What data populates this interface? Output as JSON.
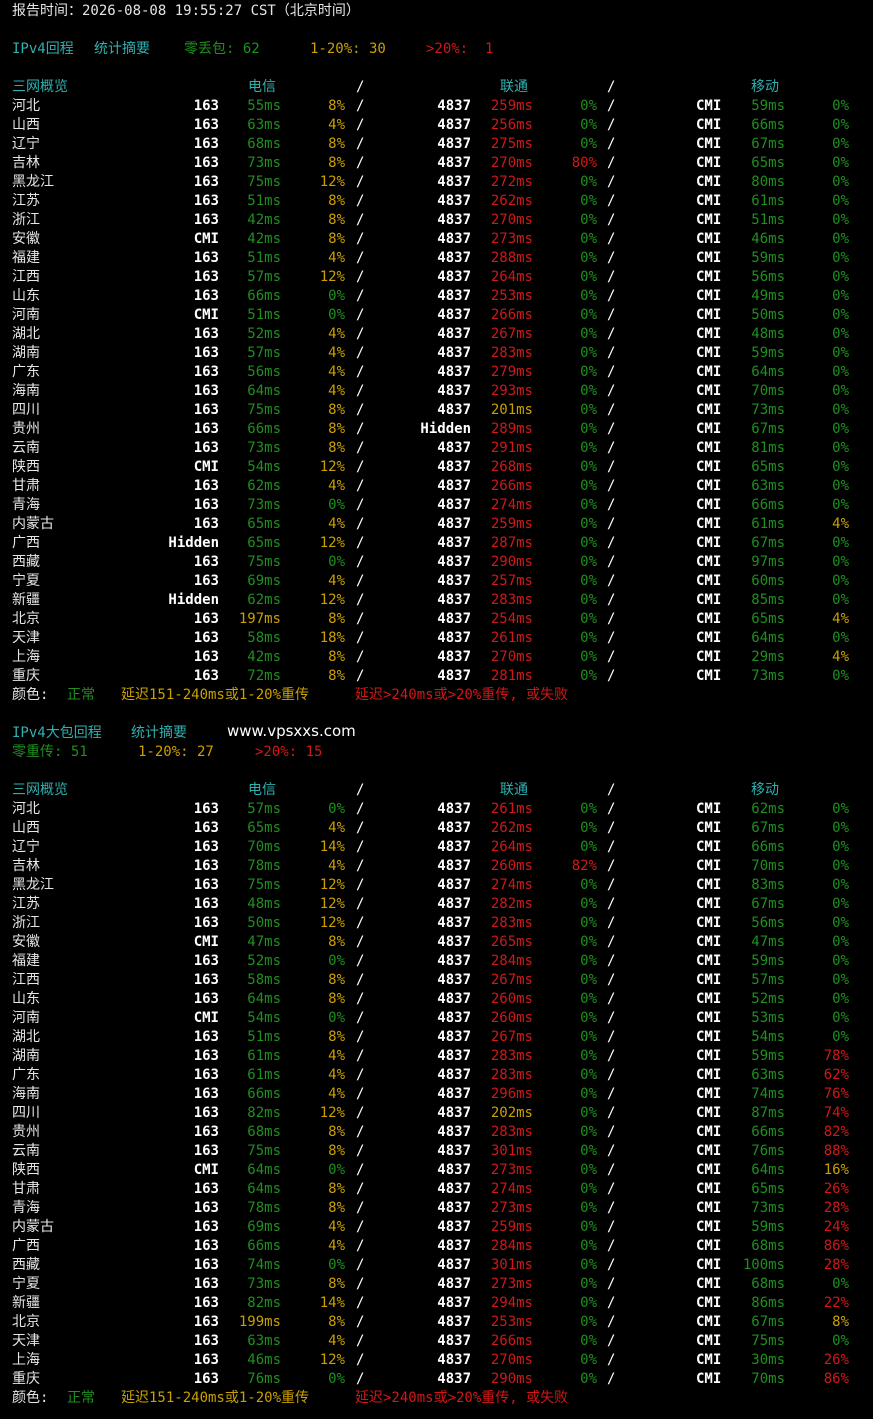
{
  "colors": {
    "green": "#1f8f1f",
    "yellow": "#c9a000",
    "red": "#d01818",
    "cyan": "#2fb0b0",
    "white": "#ffffff",
    "background": "#000000"
  },
  "report_time": "报告时间：2026-08-08 19:55:27 CST（北京时间）",
  "sections": [
    {
      "title_left": "IPv4回程",
      "title_right": "统计摘要",
      "stats": [
        {
          "text": "零丢包: 62",
          "color": "green"
        },
        {
          "text": "1-20%: 30",
          "color": "yellow"
        },
        {
          "text": ">20%:  1",
          "color": "red"
        }
      ],
      "watermark": "",
      "header": {
        "region": "三网概览",
        "telecom": "电信",
        "sep": "/",
        "unicom": "联通",
        "mobile": "移动"
      },
      "rows": [
        [
          "河北",
          "163",
          "55ms",
          "8%",
          "4837",
          "259ms",
          "0%",
          "CMI",
          "59ms",
          "0%"
        ],
        [
          "山西",
          "163",
          "63ms",
          "4%",
          "4837",
          "256ms",
          "0%",
          "CMI",
          "66ms",
          "0%"
        ],
        [
          "辽宁",
          "163",
          "68ms",
          "8%",
          "4837",
          "275ms",
          "0%",
          "CMI",
          "67ms",
          "0%"
        ],
        [
          "吉林",
          "163",
          "73ms",
          "8%",
          "4837",
          "270ms",
          "80%",
          "CMI",
          "65ms",
          "0%"
        ],
        [
          "黑龙江",
          "163",
          "75ms",
          "12%",
          "4837",
          "272ms",
          "0%",
          "CMI",
          "80ms",
          "0%"
        ],
        [
          "江苏",
          "163",
          "51ms",
          "8%",
          "4837",
          "262ms",
          "0%",
          "CMI",
          "61ms",
          "0%"
        ],
        [
          "浙江",
          "163",
          "42ms",
          "8%",
          "4837",
          "270ms",
          "0%",
          "CMI",
          "51ms",
          "0%"
        ],
        [
          "安徽",
          "CMI",
          "42ms",
          "8%",
          "4837",
          "273ms",
          "0%",
          "CMI",
          "46ms",
          "0%"
        ],
        [
          "福建",
          "163",
          "51ms",
          "4%",
          "4837",
          "288ms",
          "0%",
          "CMI",
          "59ms",
          "0%"
        ],
        [
          "江西",
          "163",
          "57ms",
          "12%",
          "4837",
          "264ms",
          "0%",
          "CMI",
          "56ms",
          "0%"
        ],
        [
          "山东",
          "163",
          "66ms",
          "0%",
          "4837",
          "253ms",
          "0%",
          "CMI",
          "49ms",
          "0%"
        ],
        [
          "河南",
          "CMI",
          "51ms",
          "0%",
          "4837",
          "266ms",
          "0%",
          "CMI",
          "50ms",
          "0%"
        ],
        [
          "湖北",
          "163",
          "52ms",
          "4%",
          "4837",
          "267ms",
          "0%",
          "CMI",
          "48ms",
          "0%"
        ],
        [
          "湖南",
          "163",
          "57ms",
          "4%",
          "4837",
          "283ms",
          "0%",
          "CMI",
          "59ms",
          "0%"
        ],
        [
          "广东",
          "163",
          "56ms",
          "4%",
          "4837",
          "279ms",
          "0%",
          "CMI",
          "64ms",
          "0%"
        ],
        [
          "海南",
          "163",
          "64ms",
          "4%",
          "4837",
          "293ms",
          "0%",
          "CMI",
          "70ms",
          "0%"
        ],
        [
          "四川",
          "163",
          "75ms",
          "8%",
          "4837",
          "201ms",
          "0%",
          "CMI",
          "73ms",
          "0%"
        ],
        [
          "贵州",
          "163",
          "66ms",
          "8%",
          "Hidden",
          "289ms",
          "0%",
          "CMI",
          "67ms",
          "0%"
        ],
        [
          "云南",
          "163",
          "73ms",
          "8%",
          "4837",
          "291ms",
          "0%",
          "CMI",
          "81ms",
          "0%"
        ],
        [
          "陕西",
          "CMI",
          "54ms",
          "12%",
          "4837",
          "268ms",
          "0%",
          "CMI",
          "65ms",
          "0%"
        ],
        [
          "甘肃",
          "163",
          "62ms",
          "4%",
          "4837",
          "266ms",
          "0%",
          "CMI",
          "63ms",
          "0%"
        ],
        [
          "青海",
          "163",
          "73ms",
          "0%",
          "4837",
          "274ms",
          "0%",
          "CMI",
          "66ms",
          "0%"
        ],
        [
          "内蒙古",
          "163",
          "65ms",
          "4%",
          "4837",
          "259ms",
          "0%",
          "CMI",
          "61ms",
          "4%"
        ],
        [
          "广西",
          "Hidden",
          "65ms",
          "12%",
          "4837",
          "287ms",
          "0%",
          "CMI",
          "67ms",
          "0%"
        ],
        [
          "西藏",
          "163",
          "75ms",
          "0%",
          "4837",
          "290ms",
          "0%",
          "CMI",
          "97ms",
          "0%"
        ],
        [
          "宁夏",
          "163",
          "69ms",
          "4%",
          "4837",
          "257ms",
          "0%",
          "CMI",
          "60ms",
          "0%"
        ],
        [
          "新疆",
          "Hidden",
          "62ms",
          "12%",
          "4837",
          "283ms",
          "0%",
          "CMI",
          "85ms",
          "0%"
        ],
        [
          "北京",
          "163",
          "197ms",
          "8%",
          "4837",
          "254ms",
          "0%",
          "CMI",
          "65ms",
          "4%"
        ],
        [
          "天津",
          "163",
          "58ms",
          "18%",
          "4837",
          "261ms",
          "0%",
          "CMI",
          "64ms",
          "0%"
        ],
        [
          "上海",
          "163",
          "42ms",
          "8%",
          "4837",
          "270ms",
          "0%",
          "CMI",
          "29ms",
          "4%"
        ],
        [
          "重庆",
          "163",
          "72ms",
          "8%",
          "4837",
          "281ms",
          "0%",
          "CMI",
          "73ms",
          "0%"
        ]
      ],
      "legend": {
        "label": "颜色:",
        "normal": "正常",
        "mid": "延迟151-240ms或1-20%重传",
        "bad": "延迟>240ms或>20%重传, 或失败"
      }
    },
    {
      "title_left": "IPv4大包回程",
      "title_right": "统计摘要",
      "watermark": "www.vpsxxs.com",
      "stats": [
        {
          "text": "零重传: 51",
          "color": "green"
        },
        {
          "text": "1-20%: 27",
          "color": "yellow"
        },
        {
          "text": ">20%: 15",
          "color": "red"
        }
      ],
      "header": {
        "region": "三网概览",
        "telecom": "电信",
        "sep": "/",
        "unicom": "联通",
        "mobile": "移动"
      },
      "rows": [
        [
          "河北",
          "163",
          "57ms",
          "0%",
          "4837",
          "261ms",
          "0%",
          "CMI",
          "62ms",
          "0%"
        ],
        [
          "山西",
          "163",
          "65ms",
          "4%",
          "4837",
          "262ms",
          "0%",
          "CMI",
          "67ms",
          "0%"
        ],
        [
          "辽宁",
          "163",
          "70ms",
          "14%",
          "4837",
          "264ms",
          "0%",
          "CMI",
          "66ms",
          "0%"
        ],
        [
          "吉林",
          "163",
          "78ms",
          "4%",
          "4837",
          "260ms",
          "82%",
          "CMI",
          "70ms",
          "0%"
        ],
        [
          "黑龙江",
          "163",
          "75ms",
          "12%",
          "4837",
          "274ms",
          "0%",
          "CMI",
          "83ms",
          "0%"
        ],
        [
          "江苏",
          "163",
          "48ms",
          "12%",
          "4837",
          "282ms",
          "0%",
          "CMI",
          "67ms",
          "0%"
        ],
        [
          "浙江",
          "163",
          "50ms",
          "12%",
          "4837",
          "283ms",
          "0%",
          "CMI",
          "56ms",
          "0%"
        ],
        [
          "安徽",
          "CMI",
          "47ms",
          "8%",
          "4837",
          "265ms",
          "0%",
          "CMI",
          "47ms",
          "0%"
        ],
        [
          "福建",
          "163",
          "52ms",
          "0%",
          "4837",
          "284ms",
          "0%",
          "CMI",
          "59ms",
          "0%"
        ],
        [
          "江西",
          "163",
          "58ms",
          "8%",
          "4837",
          "267ms",
          "0%",
          "CMI",
          "57ms",
          "0%"
        ],
        [
          "山东",
          "163",
          "64ms",
          "8%",
          "4837",
          "260ms",
          "0%",
          "CMI",
          "52ms",
          "0%"
        ],
        [
          "河南",
          "CMI",
          "54ms",
          "0%",
          "4837",
          "260ms",
          "0%",
          "CMI",
          "53ms",
          "0%"
        ],
        [
          "湖北",
          "163",
          "51ms",
          "8%",
          "4837",
          "267ms",
          "0%",
          "CMI",
          "54ms",
          "0%"
        ],
        [
          "湖南",
          "163",
          "61ms",
          "4%",
          "4837",
          "283ms",
          "0%",
          "CMI",
          "59ms",
          "78%"
        ],
        [
          "广东",
          "163",
          "61ms",
          "4%",
          "4837",
          "283ms",
          "0%",
          "CMI",
          "63ms",
          "62%"
        ],
        [
          "海南",
          "163",
          "66ms",
          "4%",
          "4837",
          "296ms",
          "0%",
          "CMI",
          "74ms",
          "76%"
        ],
        [
          "四川",
          "163",
          "82ms",
          "12%",
          "4837",
          "202ms",
          "0%",
          "CMI",
          "87ms",
          "74%"
        ],
        [
          "贵州",
          "163",
          "68ms",
          "8%",
          "4837",
          "283ms",
          "0%",
          "CMI",
          "66ms",
          "82%"
        ],
        [
          "云南",
          "163",
          "75ms",
          "8%",
          "4837",
          "301ms",
          "0%",
          "CMI",
          "76ms",
          "88%"
        ],
        [
          "陕西",
          "CMI",
          "64ms",
          "0%",
          "4837",
          "273ms",
          "0%",
          "CMI",
          "64ms",
          "16%"
        ],
        [
          "甘肃",
          "163",
          "64ms",
          "8%",
          "4837",
          "274ms",
          "0%",
          "CMI",
          "65ms",
          "26%"
        ],
        [
          "青海",
          "163",
          "78ms",
          "8%",
          "4837",
          "273ms",
          "0%",
          "CMI",
          "73ms",
          "28%"
        ],
        [
          "内蒙古",
          "163",
          "69ms",
          "4%",
          "4837",
          "259ms",
          "0%",
          "CMI",
          "59ms",
          "24%"
        ],
        [
          "广西",
          "163",
          "66ms",
          "4%",
          "4837",
          "284ms",
          "0%",
          "CMI",
          "68ms",
          "86%"
        ],
        [
          "西藏",
          "163",
          "74ms",
          "0%",
          "4837",
          "301ms",
          "0%",
          "CMI",
          "100ms",
          "28%"
        ],
        [
          "宁夏",
          "163",
          "73ms",
          "8%",
          "4837",
          "273ms",
          "0%",
          "CMI",
          "68ms",
          "0%"
        ],
        [
          "新疆",
          "163",
          "82ms",
          "14%",
          "4837",
          "294ms",
          "0%",
          "CMI",
          "86ms",
          "22%"
        ],
        [
          "北京",
          "163",
          "199ms",
          "8%",
          "4837",
          "253ms",
          "0%",
          "CMI",
          "67ms",
          "8%"
        ],
        [
          "天津",
          "163",
          "63ms",
          "4%",
          "4837",
          "266ms",
          "0%",
          "CMI",
          "75ms",
          "0%"
        ],
        [
          "上海",
          "163",
          "46ms",
          "12%",
          "4837",
          "270ms",
          "0%",
          "CMI",
          "30ms",
          "26%"
        ],
        [
          "重庆",
          "163",
          "76ms",
          "0%",
          "4837",
          "290ms",
          "0%",
          "CMI",
          "70ms",
          "86%"
        ]
      ],
      "legend": {
        "label": "颜色:",
        "normal": "正常",
        "mid": "延迟151-240ms或1-20%重传",
        "bad": "延迟>240ms或>20%重传, 或失败"
      }
    }
  ]
}
